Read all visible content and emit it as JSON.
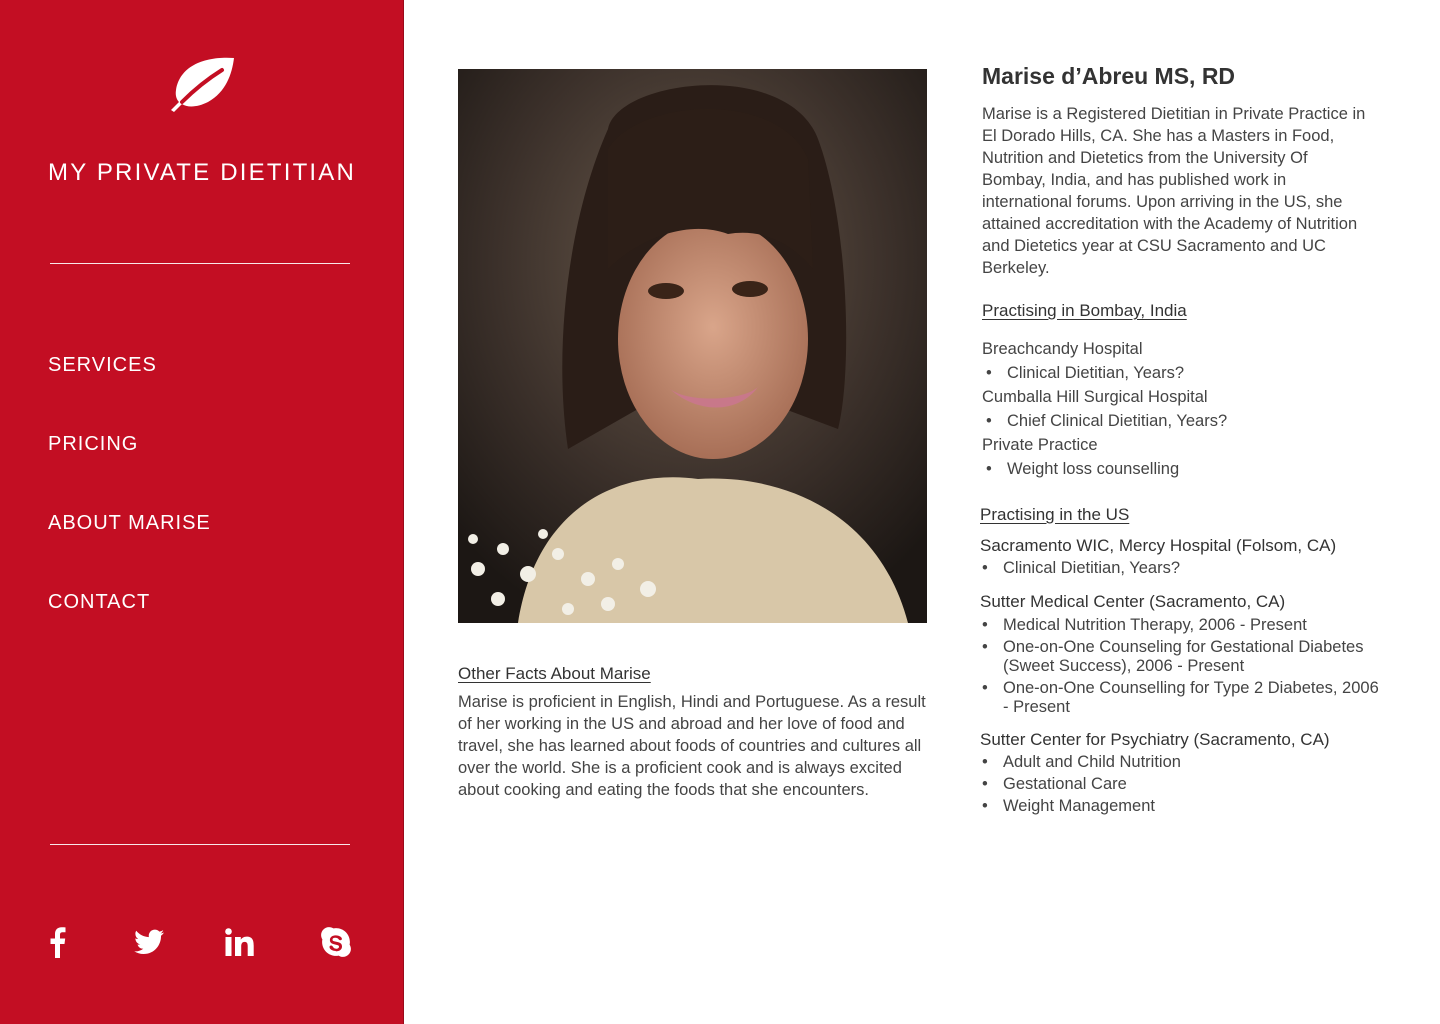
{
  "brand": {
    "name": "MY PRIVATE DIETITIAN",
    "logo_icon": "leaf-icon"
  },
  "nav": [
    {
      "label": "SERVICES"
    },
    {
      "label": "PRICING"
    },
    {
      "label": "ABOUT MARISE"
    },
    {
      "label": "CONTACT"
    }
  ],
  "social": [
    "facebook-icon",
    "twitter-icon",
    "linkedin-icon",
    "skype-icon"
  ],
  "colors": {
    "sidebar": "#c30e23",
    "text": "#333333",
    "background": "#ffffff"
  },
  "profile": {
    "name": "Marise d’Abreu MS, RD",
    "bio": "Marise is a Registered Dietitian in Private Practice in El Dorado Hills, CA. She has a Masters in Food, Nutrition and Dietetics from the University Of Bombay, India, and has published work in international forums. Upon arriving in the US, she attained accreditation with the Academy of Nutrition and Dietetics year at CSU Sacramento and UC Berkeley."
  },
  "india": {
    "title": "Practising in Bombay, India",
    "entries": [
      {
        "place": "Breachcandy Hospital",
        "role": "Clinical Dietitian, Years?"
      },
      {
        "place": "Cumballa Hill Surgical Hospital",
        "role": "Chief Clinical Dietitian, Years?"
      },
      {
        "place": "Private Practice",
        "role": "Weight loss counselling"
      }
    ]
  },
  "us": {
    "title": "Practising in the US",
    "groups": [
      {
        "place": "Sacramento WIC, Mercy Hospital (Folsom, CA)",
        "items": [
          "Clinical Dietitian, Years?"
        ]
      },
      {
        "place": "Sutter Medical Center (Sacramento, CA)",
        "items": [
          "Medical Nutrition Therapy, 2006 - Present",
          "One-on-One Counseling for Gestational Diabetes (Sweet Success), 2006 - Present",
          "One-on-One Counselling for Type 2 Diabetes, 2006 - Present"
        ]
      },
      {
        "place": "Sutter Center for Psychiatry (Sacramento, CA)",
        "items": [
          "Adult and Child Nutrition",
          "Gestational Care",
          "Weight Management"
        ]
      }
    ]
  },
  "facts": {
    "title": "Other Facts About Marise",
    "text": "Marise is proficient in English, Hindi and Portuguese. As a result of her working in the US and abroad and her love of food and travel, she has learned about foods of countries and cultures all over the world. She is a proficient cook and is always excited about cooking and eating the foods that she encounters."
  }
}
